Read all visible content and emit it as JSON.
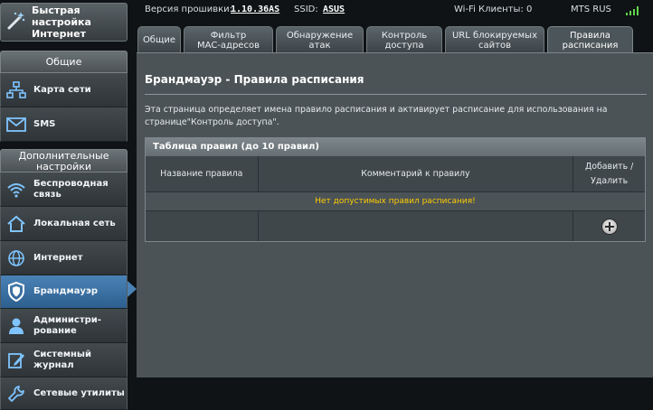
{
  "sidebar": {
    "quick_setup": "Быстрая настройка\nИнтернет",
    "general_header": "Общие",
    "general_items": [
      {
        "label": "Карта сети",
        "icon": "network-map-icon"
      },
      {
        "label": "SMS",
        "icon": "envelope-icon"
      }
    ],
    "advanced_header": "Дополнительные\nнастройки",
    "advanced_items": [
      {
        "label": "Беспроводная\nсвязь",
        "icon": "wireless-icon"
      },
      {
        "label": "Локальная сеть",
        "icon": "home-icon"
      },
      {
        "label": "Интернет",
        "icon": "globe-icon"
      },
      {
        "label": "Брандмауэр",
        "icon": "shield-icon",
        "active": true
      },
      {
        "label": "Администри-\nрование",
        "icon": "user-icon"
      },
      {
        "label": "Системный\nжурнал",
        "icon": "log-edit-icon"
      },
      {
        "label": "Сетевые утилиты",
        "icon": "wrench-icon"
      }
    ]
  },
  "status_bar": {
    "firmware_label": "Версия прошивки:",
    "firmware_value": "1.10.36AS",
    "ssid_label": "SSID:",
    "ssid_value": "ASUS",
    "wifi_clients": "Wi-Fi Клиенты: 0",
    "operator": "MTS RUS",
    "signal_icon": "signal-bars-icon",
    "signal_color": "#61d64a"
  },
  "tabs": [
    {
      "label": "Общие"
    },
    {
      "label": "Фильтр\nMAC-адресов"
    },
    {
      "label": "Обнаружение\nатак"
    },
    {
      "label": "Контроль\nдоступа"
    },
    {
      "label": "URL блокируемых\nсайтов"
    },
    {
      "label": "Правила\nрасписания",
      "active": true
    }
  ],
  "main": {
    "title": "Брандмауэр - Правила расписания",
    "description": "Эта страница определяет имена правило расписания и активирует расписание для использования на странице\"Контроль доступа\".",
    "table": {
      "title": "Таблица правил (до 10 правил)",
      "columns": [
        "Название правила",
        "Комментарий к правилу",
        "Добавить /\nУдалить"
      ],
      "empty_message": "Нет допустимых правил расписания!",
      "add_icon": "plus-circle-icon"
    }
  },
  "colors": {
    "accent_active": "#4a82b6",
    "empty_message": "#ffcc00"
  }
}
